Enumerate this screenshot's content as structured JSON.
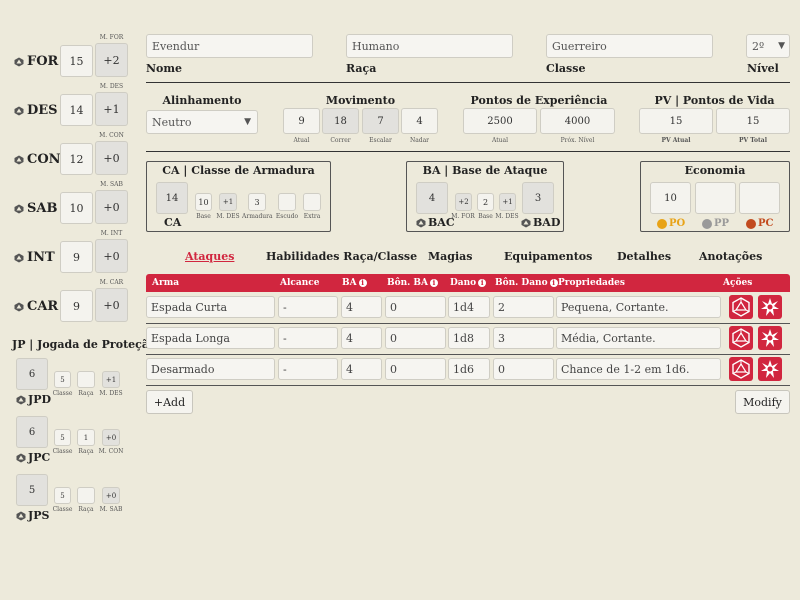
{
  "attributes": [
    {
      "abbr": "FOR",
      "value": "15",
      "mod_label": "M. FOR",
      "mod": "+2"
    },
    {
      "abbr": "DES",
      "value": "14",
      "mod_label": "M. DES",
      "mod": "+1"
    },
    {
      "abbr": "CON",
      "value": "12",
      "mod_label": "M. CON",
      "mod": "+0"
    },
    {
      "abbr": "SAB",
      "value": "10",
      "mod_label": "M. SAB",
      "mod": "+0"
    },
    {
      "abbr": "INT",
      "value": "9",
      "mod_label": "M. INT",
      "mod": "+0"
    },
    {
      "abbr": "CAR",
      "value": "9",
      "mod_label": "M. CAR",
      "mod": "+0"
    }
  ],
  "saves": {
    "title": "JP | Jogada de Proteção",
    "items": [
      {
        "name": "JPD",
        "value": "6",
        "classe": "5",
        "raca": "",
        "mod": "+1",
        "mod_label": "M. DES"
      },
      {
        "name": "JPC",
        "value": "6",
        "classe": "5",
        "raca": "1",
        "mod": "+0",
        "mod_label": "M. CON"
      },
      {
        "name": "JPS",
        "value": "5",
        "classe": "5",
        "raca": "",
        "mod": "+0",
        "mod_label": "M. SAB"
      }
    ],
    "classe_label": "Classe",
    "raca_label": "Raça"
  },
  "header": {
    "nome": {
      "value": "Evendur",
      "label": "Nome"
    },
    "raca": {
      "value": "Humano",
      "label": "Raça"
    },
    "classe": {
      "value": "Guerreiro",
      "label": "Classe"
    },
    "nivel": {
      "value": "2º",
      "label": "Nível"
    }
  },
  "row2": {
    "alinhamento": {
      "title": "Alinhamento",
      "value": "Neutro"
    },
    "movimento": {
      "title": "Movimento",
      "values": [
        "9",
        "18",
        "7",
        "4"
      ],
      "labels": [
        "Atual",
        "Correr",
        "Escalar",
        "Nadar"
      ]
    },
    "xp": {
      "title": "Pontos de Experiência",
      "atual": "2500",
      "proximo": "4000",
      "atual_label": "Atual",
      "proximo_label": "Próx. Nível"
    },
    "pv": {
      "title": "PV | Pontos de Vida",
      "atual": "15",
      "total": "15",
      "atual_label": "PV Atual",
      "total_label": "PV Total"
    }
  },
  "ca": {
    "title": "CA | Classe de Armadura",
    "total": "14",
    "total_label": "CA",
    "base": "10",
    "mdes": "+1",
    "armadura": "3",
    "escudo": "",
    "extra": "",
    "labels": [
      "Base",
      "M. DES",
      "Armadura",
      "Escudo",
      "Extra"
    ]
  },
  "ba": {
    "title": "BA | Base de Ataque",
    "bac": "4",
    "bac_label": "BAC",
    "mfor": "+2",
    "base": "2",
    "mdes": "+1",
    "bad": "3",
    "bad_label": "BAD",
    "labels": [
      "M. FOR",
      "Base",
      "M. DES"
    ]
  },
  "economia": {
    "title": "Economia",
    "po": "10",
    "pp": "",
    "pc": "",
    "po_label": "PO",
    "pp_label": "PP",
    "pc_label": "PC"
  },
  "tabs": [
    "Ataques",
    "Habilidades Raça/Classe",
    "Magias",
    "Equipamentos",
    "Detalhes",
    "Anotações"
  ],
  "table": {
    "headers": [
      "Arma",
      "Alcance",
      "BA",
      "Bôn. BA",
      "Dano",
      "Bôn. Dano",
      "Propriedades",
      "Ações"
    ],
    "rows": [
      {
        "arma": "Espada Curta",
        "alcance": "-",
        "ba": "4",
        "bon_ba": "0",
        "dano": "1d4",
        "bon_dano": "2",
        "prop": "Pequena, Cortante."
      },
      {
        "arma": "Espada Longa",
        "alcance": "-",
        "ba": "4",
        "bon_ba": "0",
        "dano": "1d8",
        "bon_dano": "3",
        "prop": "Média, Cortante."
      },
      {
        "arma": "Desarmado",
        "alcance": "-",
        "ba": "4",
        "bon_ba": "0",
        "dano": "1d6",
        "bon_dano": "0",
        "prop": "Chance de 1-2 em 1d6."
      }
    ]
  },
  "buttons": {
    "add": "+Add",
    "modify": "Modify"
  },
  "colors": {
    "accent": "#d1263f",
    "gold": "#e8a317",
    "silver": "#9a9a9a",
    "copper": "#c24b1f"
  }
}
